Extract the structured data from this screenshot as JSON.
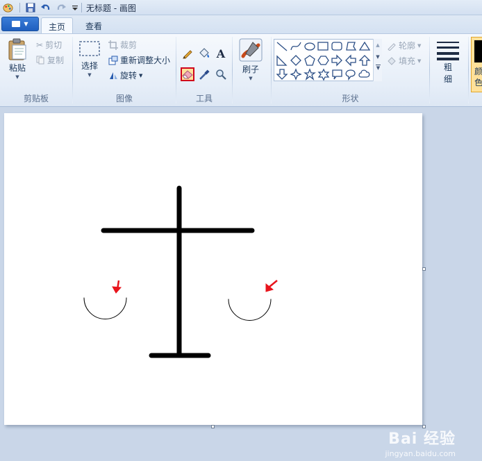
{
  "window": {
    "title": "无标题 - 画图"
  },
  "tabs": [
    {
      "label": "主页",
      "active": true
    },
    {
      "label": "查看",
      "active": false
    }
  ],
  "clipboard": {
    "paste": "粘贴",
    "cut": "剪切",
    "copy": "复制",
    "group": "剪贴板"
  },
  "image": {
    "select": "选择",
    "crop": "裁剪",
    "resize": "重新调整大小",
    "rotate": "旋转",
    "group": "图像"
  },
  "tools": {
    "group": "工具",
    "items": [
      "pencil-icon",
      "fill-bucket-icon",
      "text-icon",
      "eraser-icon",
      "color-picker-icon",
      "magnifier-icon"
    ],
    "selected": "eraser-icon"
  },
  "brushes": {
    "label": "刷子"
  },
  "shapes": {
    "group": "形状",
    "outline": "轮廓",
    "fill": "填充"
  },
  "size": {
    "label_line1": "粗",
    "label_line2": "细"
  },
  "color1": {
    "label_line1": "颜",
    "label_line2": "色"
  },
  "colors": {
    "accent_selected": "#d0021b",
    "annotation_arrow": "#e8141c",
    "ink": "#000000"
  },
  "watermark": {
    "brand": "Bai 经验",
    "url": "jingyan.baidu.com"
  }
}
